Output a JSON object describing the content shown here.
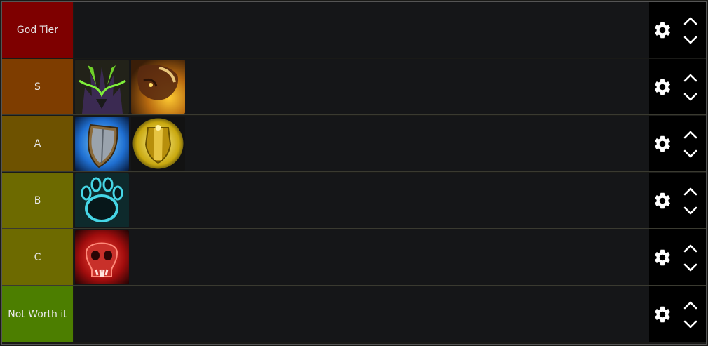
{
  "tiers": [
    {
      "label": "God Tier",
      "color": "#7e0000",
      "items": []
    },
    {
      "label": "S",
      "color": "#7e3d00",
      "items": [
        "demon-hunter-icon",
        "hunter-beast-icon"
      ]
    },
    {
      "label": "A",
      "color": "#6e5200",
      "items": [
        "shield-icon",
        "golden-shield-icon"
      ]
    },
    {
      "label": "B",
      "color": "#6d6a00",
      "items": [
        "bear-paw-icon"
      ]
    },
    {
      "label": "C",
      "color": "#6d6a00",
      "items": [
        "skull-icon"
      ]
    },
    {
      "label": "Not Worth it",
      "color": "#4c7e00",
      "items": []
    }
  ],
  "controls": {
    "settings_icon": "gear-icon",
    "move_up_icon": "chevron-up-icon",
    "move_down_icon": "chevron-down-icon"
  }
}
